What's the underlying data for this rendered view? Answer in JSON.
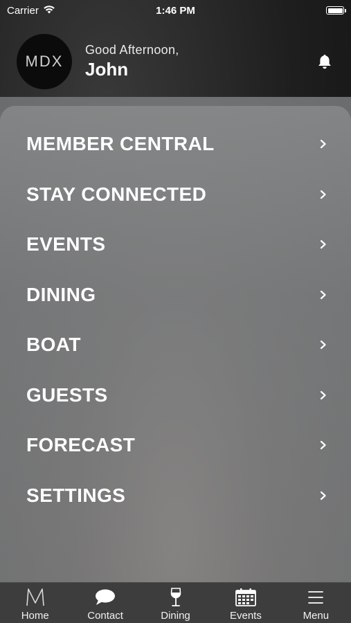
{
  "status_bar": {
    "carrier": "Carrier",
    "time": "1:46 PM",
    "battery_level": 1.0
  },
  "header": {
    "avatar_text": "MDX",
    "greeting": "Good Afternoon,",
    "name": "John",
    "notification_icon": "bell-icon"
  },
  "menu": {
    "items": [
      {
        "label": "MEMBER CENTRAL"
      },
      {
        "label": "STAY CONNECTED"
      },
      {
        "label": "EVENTS"
      },
      {
        "label": "DINING"
      },
      {
        "label": "BOAT"
      },
      {
        "label": "GUESTS"
      },
      {
        "label": "FORECAST"
      },
      {
        "label": "SETTINGS"
      }
    ],
    "chevron_icon": "chevron-right-icon"
  },
  "tabbar": {
    "tabs": [
      {
        "label": "Home",
        "icon": "m-logo-icon"
      },
      {
        "label": "Contact",
        "icon": "chat-bubble-icon"
      },
      {
        "label": "Dining",
        "icon": "wine-glass-icon"
      },
      {
        "label": "Events",
        "icon": "calendar-icon"
      },
      {
        "label": "Menu",
        "icon": "hamburger-icon"
      }
    ]
  },
  "colors": {
    "tabbar_bg": "#3d3d3d",
    "text": "#ffffff"
  }
}
